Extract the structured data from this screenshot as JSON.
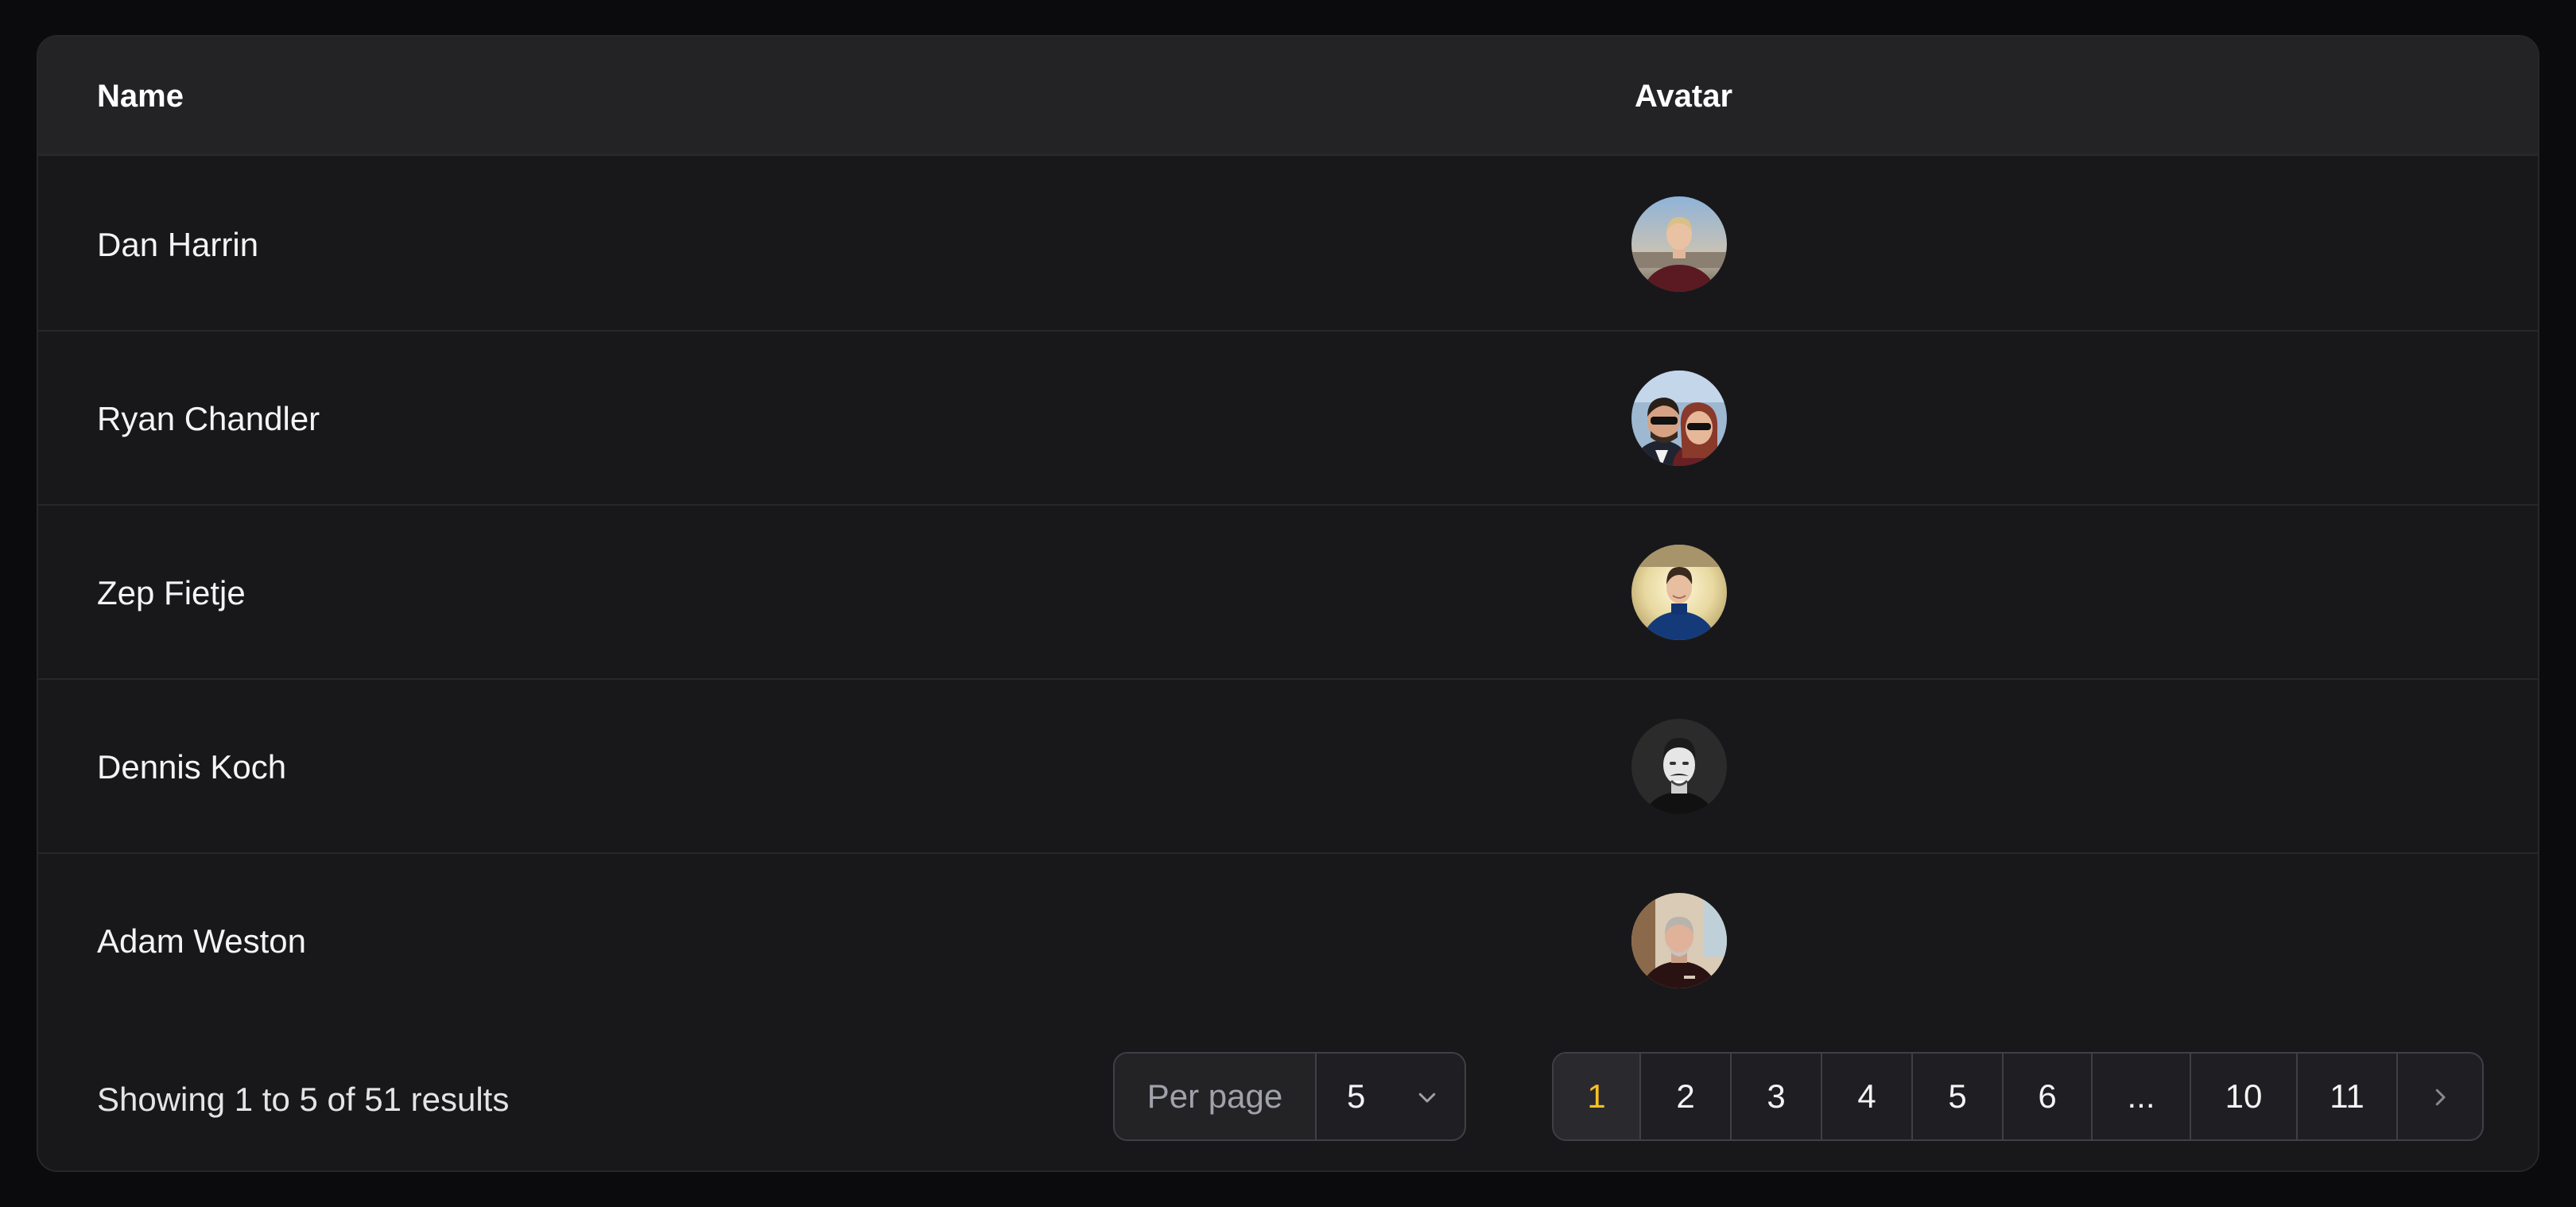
{
  "table": {
    "headers": {
      "name": "Name",
      "avatar": "Avatar"
    },
    "rows": [
      {
        "name": "Dan Harrin"
      },
      {
        "name": "Ryan Chandler"
      },
      {
        "name": "Zep Fietje"
      },
      {
        "name": "Dennis Koch"
      },
      {
        "name": "Adam Weston"
      }
    ]
  },
  "footer": {
    "summary": "Showing 1 to 5 of 51 results",
    "per_page_label": "Per page",
    "per_page_value": "5",
    "pages": [
      "1",
      "2",
      "3",
      "4",
      "5",
      "6",
      "...",
      "10",
      "11"
    ],
    "active_page": "1"
  },
  "colors": {
    "background": "#0b0b0d",
    "card": "#18181b",
    "header": "#232326",
    "active_page": "#fbbf24"
  },
  "icons": {
    "per_page_dropdown": "chevron-down-icon",
    "next_page": "chevron-right-icon"
  }
}
